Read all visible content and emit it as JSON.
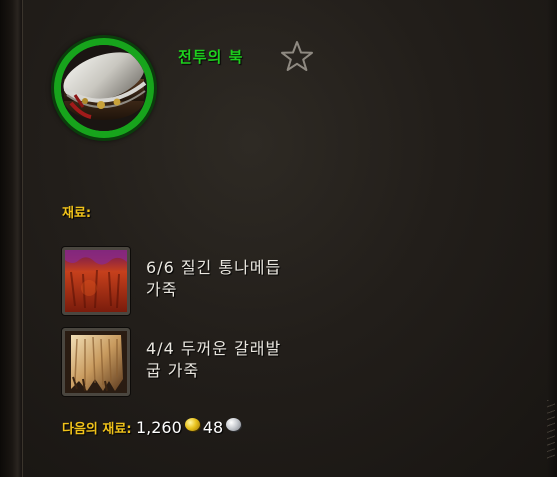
{
  "item": {
    "name": "전투의 북",
    "name_color": "#1ed01e",
    "quality_ring_color": "#17a41c",
    "icon": "war-drum-icon",
    "favorite_icon": "star-outline-icon"
  },
  "reagents": {
    "label": "재료:",
    "label_color": "#f0c21a",
    "items": [
      {
        "count": "6/6",
        "line1": "6/6 질긴 통나메듭",
        "line2": "가죽",
        "icon": "knothide-leather-icon"
      },
      {
        "count": "4/4",
        "line1": "4/4 두꺼운 갈래발",
        "line2": "굽 가죽",
        "icon": "thick-clefthoof-leather-icon"
      }
    ]
  },
  "vendor": {
    "label": "다음의 재료:",
    "gold": "1,260",
    "silver": "48",
    "gold_icon": "gold-coin-icon",
    "silver_icon": "silver-coin-icon"
  }
}
